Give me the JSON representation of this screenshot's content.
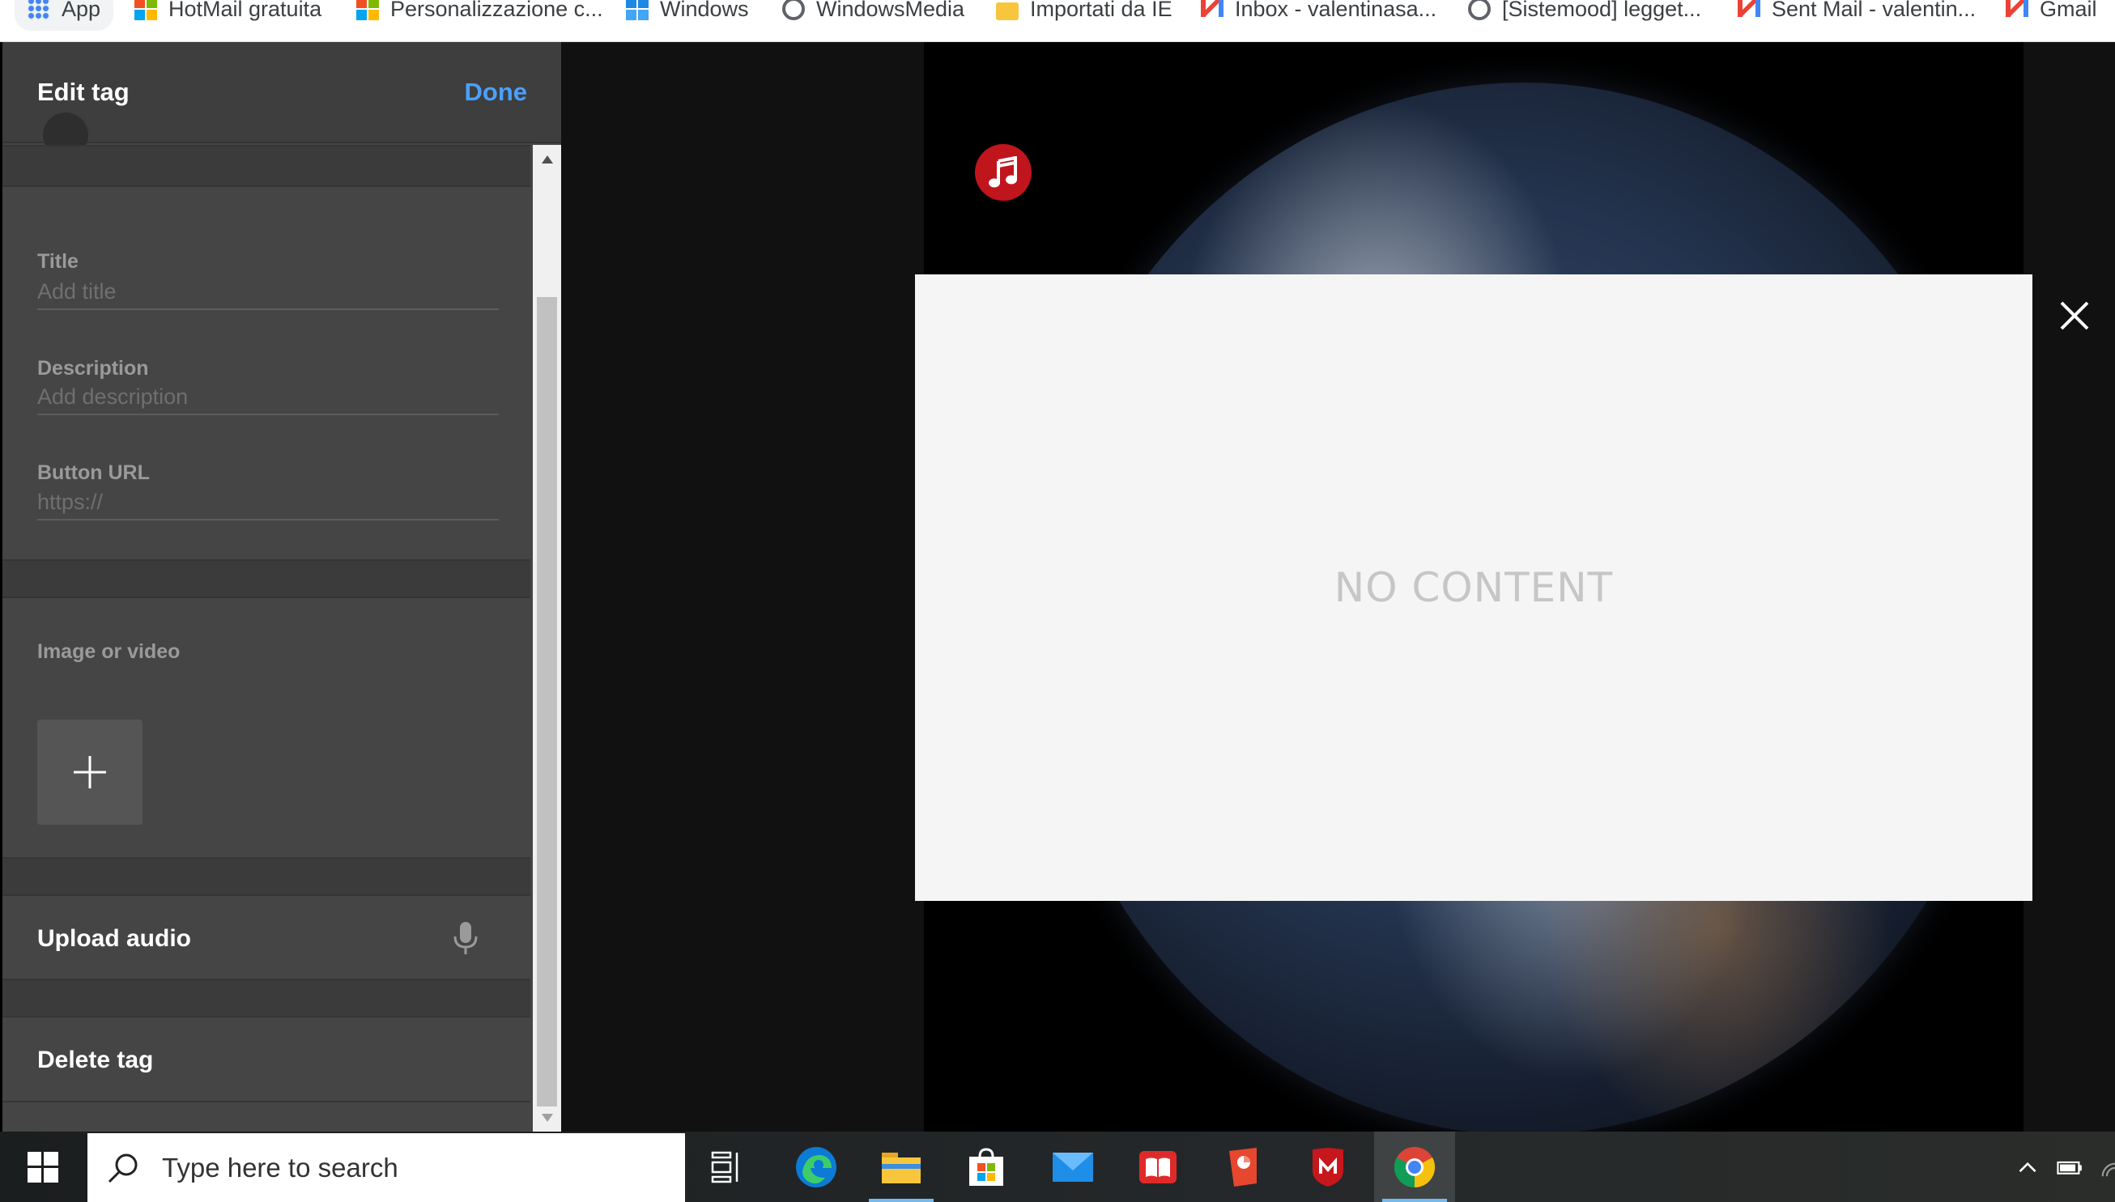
{
  "bookmarks": [
    {
      "label": "App",
      "icon": "apps-grid-icon"
    },
    {
      "label": "HotMail gratuita",
      "icon": "microsoft-icon"
    },
    {
      "label": "Personalizzazione c...",
      "icon": "microsoft-icon"
    },
    {
      "label": "Windows",
      "icon": "windows-icon"
    },
    {
      "label": "WindowsMedia",
      "icon": "globe-icon"
    },
    {
      "label": "Importati da IE",
      "icon": "folder-icon"
    },
    {
      "label": "Inbox - valentinasa...",
      "icon": "gmail-icon"
    },
    {
      "label": "[Sistemood] legget...",
      "icon": "globe-icon"
    },
    {
      "label": "Sent Mail - valentin...",
      "icon": "gmail-icon"
    },
    {
      "label": "Gmail",
      "icon": "gmail-icon"
    }
  ],
  "panel": {
    "title": "Edit tag",
    "done_label": "Done",
    "title_field": {
      "label": "Title",
      "placeholder": "Add title",
      "value": ""
    },
    "description_field": {
      "label": "Description",
      "placeholder": "Add description",
      "value": ""
    },
    "url_field": {
      "label": "Button URL",
      "placeholder": "https://",
      "value": ""
    },
    "media_label": "Image or video",
    "upload_audio_label": "Upload audio",
    "delete_tag_label": "Delete tag"
  },
  "viewer": {
    "no_content_text": "NO CONTENT"
  },
  "taskbar": {
    "search_placeholder": "Type here to search"
  },
  "colors": {
    "accent": "#4aa0ff",
    "panel_bg": "#454545",
    "music_badge": "#c0151d",
    "modal_bg": "#f5f5f5"
  }
}
